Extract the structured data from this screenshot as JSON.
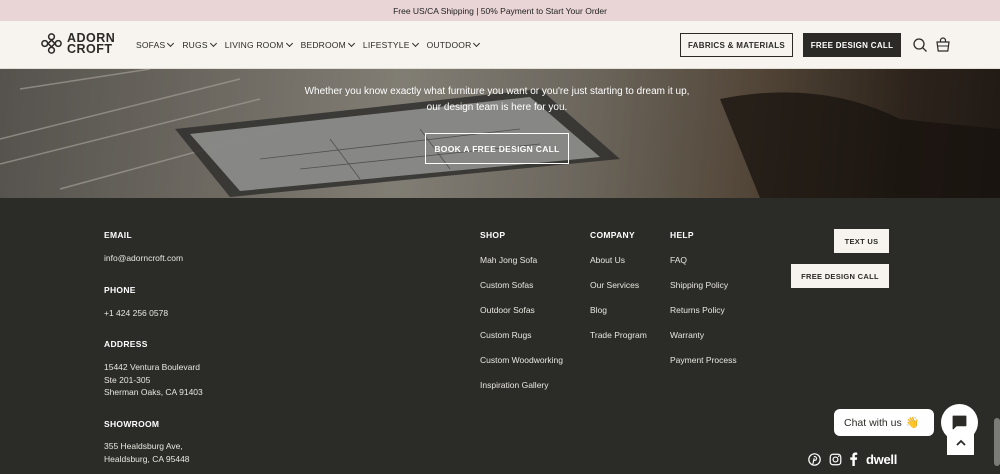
{
  "announcement": "Free US/CA Shipping | 50% Payment to Start Your Order",
  "logo": {
    "line1": "ADORN",
    "line2": "CROFT"
  },
  "nav": [
    {
      "label": "SOFAS"
    },
    {
      "label": "RUGS"
    },
    {
      "label": "LIVING ROOM"
    },
    {
      "label": "BEDROOM"
    },
    {
      "label": "LIFESTYLE"
    },
    {
      "label": "OUTDOOR"
    }
  ],
  "header_buttons": {
    "fabrics": "FABRICS & MATERIALS",
    "design_call": "FREE DESIGN CALL"
  },
  "header_icons": [
    "search-icon",
    "cart-icon"
  ],
  "hero": {
    "description": "Whether you know exactly what furniture you want or you're just starting to dream it up, our design team is here for you.",
    "button": "BOOK A FREE DESIGN CALL"
  },
  "footer": {
    "email": {
      "heading": "EMAIL",
      "value": "info@adorncroft.com"
    },
    "phone": {
      "heading": "PHONE",
      "value": "+1 424 256 0578"
    },
    "address": {
      "heading": "ADDRESS",
      "line1": "15442 Ventura Boulevard",
      "line2": "Ste 201-305",
      "line3": "Sherman Oaks, CA 91403"
    },
    "showroom": {
      "heading": "SHOWROOM",
      "line1": "355 Healdsburg Ave,",
      "line2": "Healdsburg, CA 95448"
    },
    "shop": {
      "heading": "SHOP",
      "links": [
        "Mah Jong Sofa",
        "Custom Sofas",
        "Outdoor Sofas",
        "Custom Rugs",
        "Custom Woodworking",
        "Inspiration Gallery"
      ]
    },
    "company": {
      "heading": "COMPANY",
      "links": [
        "About Us",
        "Our Services",
        "Blog",
        "Trade Program"
      ]
    },
    "help": {
      "heading": "HELP",
      "links": [
        "FAQ",
        "Shipping Policy",
        "Returns Policy",
        "Warranty",
        "Payment Process"
      ]
    },
    "buttons": {
      "text_us": "TEXT US",
      "design_call": "FREE DESIGN CALL"
    },
    "social": {
      "dwell": "dwell"
    }
  },
  "chat": {
    "label": "Chat with us",
    "emoji": "👋"
  },
  "colors": {
    "announce_bg": "#e9d5d6",
    "header_bg": "#f7f4ef",
    "footer_bg": "#2b2c28",
    "dark_button": "#2b2a27"
  }
}
